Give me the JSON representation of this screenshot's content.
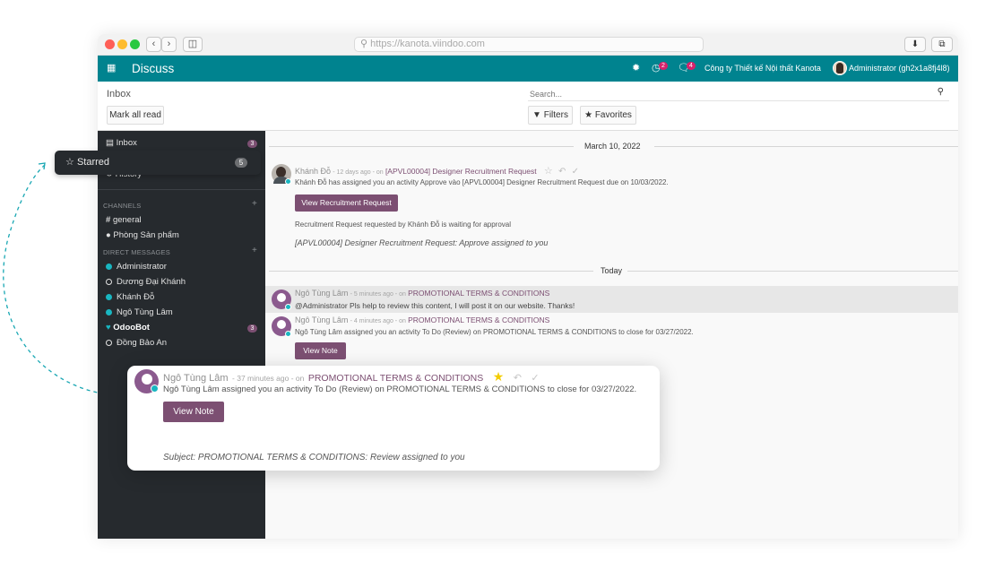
{
  "browser": {
    "url": "https://kanota.viindoo.com",
    "back_icon": "chevron-left-icon",
    "forward_icon": "chevron-right-icon"
  },
  "navbar": {
    "app_name": "Discuss",
    "activity_count": "2",
    "message_count": "4",
    "company": "Công ty Thiết kế Nội thất Kanota",
    "user": "Administrator (gh2x1a8fj4l8)"
  },
  "control": {
    "breadcrumb": "Inbox",
    "mark_all_read": "Mark all read",
    "search_placeholder": "Search...",
    "filters": "Filters",
    "favorites": "Favorites"
  },
  "sidebar": {
    "inbox": {
      "label": "Inbox",
      "count": "3"
    },
    "history": "History",
    "channels_header": "CHANNELS",
    "channels": [
      "general",
      "Phòng Sản phẩm"
    ],
    "dm_header": "DIRECT MESSAGES",
    "direct_messages": [
      {
        "name": "Administrator",
        "status": "online"
      },
      {
        "name": "Dương Đại Khánh",
        "status": "offline"
      },
      {
        "name": "Khánh Đỗ",
        "status": "online"
      },
      {
        "name": "Ngô Tùng Lâm",
        "status": "online"
      },
      {
        "name": "OdooBot",
        "status": "bot",
        "count": "3"
      },
      {
        "name": "Đồng Bảo An",
        "status": "offline"
      }
    ]
  },
  "starred_tooltip": {
    "label": "Starred",
    "count": "5"
  },
  "thread": {
    "date1": "March 10, 2022",
    "date2": "Today",
    "messages": [
      {
        "author": "Khánh Đỗ",
        "meta": "- 12 days ago - on",
        "record": "[APVL00004] Designer Recruitment Request",
        "body": "Khánh Đỗ has assigned you an activity Approve vào [APVL00004] Designer Recruitment Request due on 10/03/2022.",
        "button": "View Recruitment Request",
        "note": "Recruitment Request requested by Khánh Đỗ is waiting for approval",
        "subject": "[APVL00004] Designer Recruitment Request: Approve assigned to you"
      },
      {
        "author": "Ngô Tùng Lâm",
        "meta": "- 5 minutes ago - on",
        "record": "PROMOTIONAL TERMS & CONDITIONS",
        "body": "@Administrator Pls help to review this content, I will post it on our website. Thanks!"
      },
      {
        "author": "Ngô Tùng Lâm",
        "meta": "- 4 minutes ago - on",
        "record": "PROMOTIONAL TERMS & CONDITIONS",
        "body": "Ngô Tùng Lâm assigned you an activity To Do (Review) on PROMOTIONAL TERMS & CONDITIONS to close for 03/27/2022.",
        "button": "View Note"
      }
    ]
  },
  "zoom_card": {
    "author": "Ngô Tùng Lâm",
    "meta": "- 37 minutes ago - on",
    "record": "PROMOTIONAL TERMS & CONDITIONS",
    "body": "Ngô Tùng Lâm assigned you an activity To Do (Review) on PROMOTIONAL TERMS & CONDITIONS to close for 03/27/2022.",
    "button": "View Note",
    "subject": "Subject: PROMOTIONAL TERMS & CONDITIONS: Review assigned to you"
  },
  "colors": {
    "navbar": "#00838f",
    "primary": "#7c4f72",
    "sidebar": "#262a2e",
    "online": "#19b6c1",
    "star": "#f3cc00"
  }
}
